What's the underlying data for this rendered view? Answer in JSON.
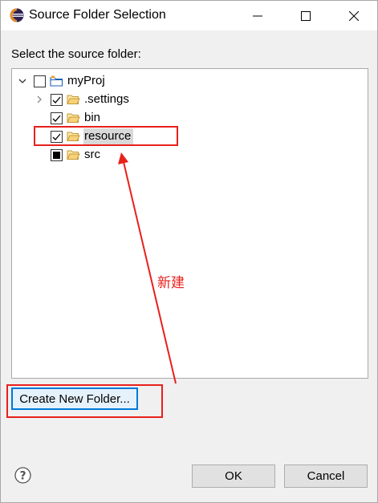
{
  "window": {
    "title": "Source Folder Selection",
    "icon": "eclipse-icon"
  },
  "prompt": "Select the source folder:",
  "tree": [
    {
      "label": "myProj",
      "checked": "unchecked",
      "icon": "project-folder-icon",
      "expanded": true,
      "level": 0
    },
    {
      "label": ".settings",
      "checked": "checked",
      "icon": "folder-icon",
      "expanded": false,
      "level": 1
    },
    {
      "label": "bin",
      "checked": "checked",
      "icon": "folder-icon",
      "level": 1
    },
    {
      "label": "resource",
      "checked": "checked",
      "icon": "folder-icon",
      "level": 1,
      "selected": true
    },
    {
      "label": "src",
      "checked": "partial",
      "icon": "folder-icon",
      "level": 1
    }
  ],
  "annotation": {
    "text": "新建",
    "color": "#e8201c"
  },
  "buttons": {
    "create_folder": "Create New Folder...",
    "ok": "OK",
    "cancel": "Cancel"
  },
  "colors": {
    "highlight": "#e8201c",
    "focus": "#0078d7"
  }
}
